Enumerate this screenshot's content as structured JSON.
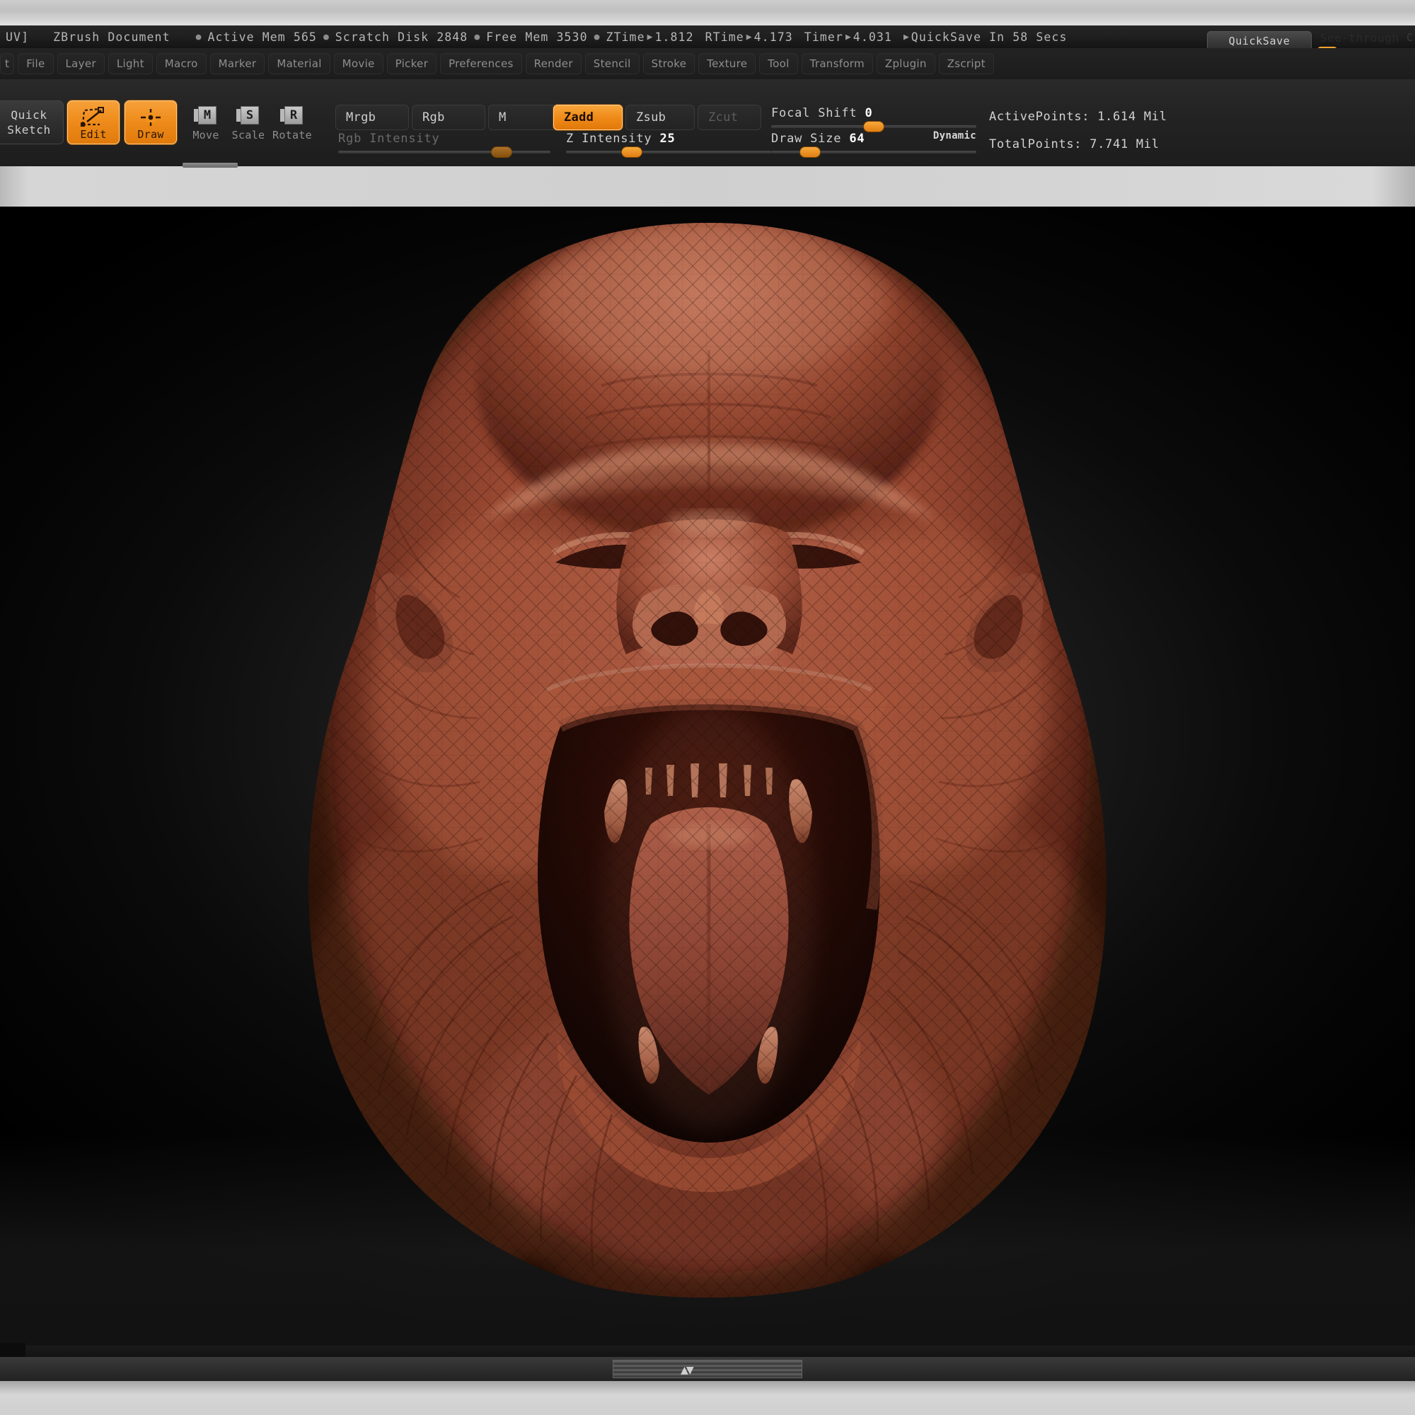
{
  "app": {
    "title": "ZBrush Document",
    "title_prefix": "UV]"
  },
  "statusbar": {
    "items": [
      {
        "label": "Active Mem",
        "value": "565"
      },
      {
        "label": "Scratch Disk",
        "value": "2848"
      },
      {
        "label": "Free Mem",
        "value": "3530"
      },
      {
        "label": "ZTime",
        "value": "1.812"
      },
      {
        "label": "RTime",
        "value": "4.173"
      },
      {
        "label": "Timer",
        "value": "4.031"
      },
      {
        "label": "QuickSave In 58 Secs",
        "value": ""
      }
    ],
    "active_mem_label": "Active Mem 565",
    "scratch_disk_label": "Scratch Disk 2848",
    "free_mem_label": "Free Mem 3530",
    "ztime_label": "ZTime",
    "ztime_value": "1.812",
    "rtime_label": "RTime",
    "rtime_value": "4.173",
    "timer_label": "Timer",
    "timer_value": "4.031",
    "quicksave_label": "QuickSave In 58 Secs",
    "quicksave_button": "QuickSave",
    "seethrough_label": "See-through",
    "corner_glyph": "C"
  },
  "menubar": {
    "items": [
      {
        "label": "t"
      },
      {
        "label": "File"
      },
      {
        "label": "Layer"
      },
      {
        "label": "Light"
      },
      {
        "label": "Macro"
      },
      {
        "label": "Marker"
      },
      {
        "label": "Material"
      },
      {
        "label": "Movie"
      },
      {
        "label": "Picker"
      },
      {
        "label": "Preferences"
      },
      {
        "label": "Render"
      },
      {
        "label": "Stencil"
      },
      {
        "label": "Stroke"
      },
      {
        "label": "Texture"
      },
      {
        "label": "Tool"
      },
      {
        "label": "Transform"
      },
      {
        "label": "Zplugin"
      },
      {
        "label": "Zscript"
      }
    ]
  },
  "toolbar": {
    "quick_sketch_line1": "Quick",
    "quick_sketch_line2": "Sketch",
    "edit_label": "Edit",
    "draw_label": "Draw",
    "move_label": "Move",
    "move_key": "M",
    "scale_label": "Scale",
    "scale_key": "S",
    "rotate_label": "Rotate",
    "rotate_key": "R",
    "mrgb_label": "Mrgb",
    "rgb_label": "Rgb",
    "m_label": "M",
    "zadd_label": "Zadd",
    "zsub_label": "Zsub",
    "zcut_label": "Zcut",
    "rgb_intensity_label": "Rgb Intensity",
    "rgb_intensity_value": "",
    "rgb_intensity_pct": 77,
    "z_intensity_label": "Z Intensity",
    "z_intensity_value": "25",
    "z_intensity_pct": 32,
    "focal_shift_label": "Focal Shift",
    "focal_shift_value": "0",
    "focal_shift_pct": 50,
    "draw_size_label": "Draw Size",
    "draw_size_value": "64",
    "draw_size_pct": 19,
    "dynamic_label": "Dynamic",
    "active_points_label": "ActivePoints:",
    "active_points_value": "1.614 Mil",
    "total_points_label": "TotalPoints:",
    "total_points_value": "7.741 Mil"
  },
  "canvas": {
    "subject": "roaring-primate-head-sculpt",
    "material_color": "#9e4a32",
    "wireframe": true,
    "background": "#0a0a0a"
  },
  "colors": {
    "accent": "#ef8c1c",
    "panel": "#242424",
    "text": "#cfcfcf",
    "sculpt_base": "#9c4630",
    "sculpt_light": "#c9765a",
    "sculpt_dark": "#4a1d13"
  }
}
